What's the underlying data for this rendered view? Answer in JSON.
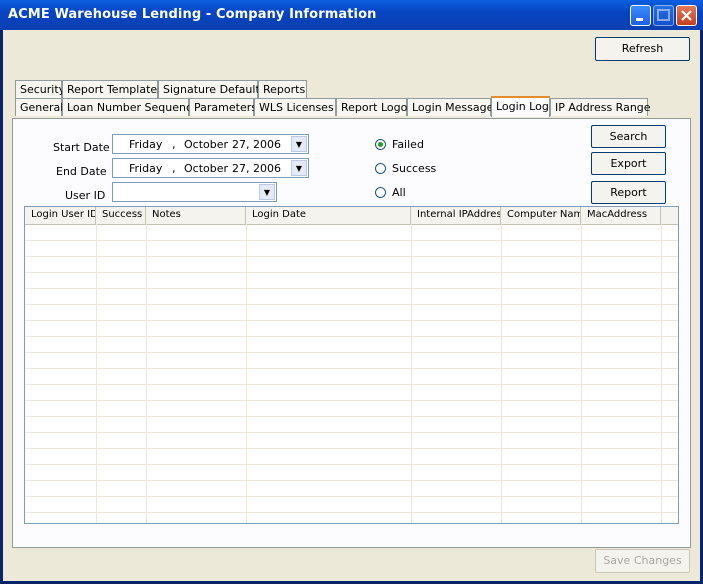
{
  "window": {
    "title": "ACME Warehouse Lending - Company Information"
  },
  "toolbar": {
    "refresh_label": "Refresh",
    "save_changes_label": "Save Changes"
  },
  "tabs_row1": [
    "Security",
    "Report Templates",
    "Signature Defaults",
    "Reports"
  ],
  "tabs_row2": [
    "General",
    "Loan Number Sequence",
    "Parameters",
    "WLS Licenses",
    "Report Logo",
    "Login Message",
    "Login Log",
    "IP Address Range"
  ],
  "active_tab": "Login Log",
  "filters": {
    "start_date_label": "Start Date",
    "start_date": {
      "day": "Friday",
      "month": "October",
      "date": "27, 2006"
    },
    "end_date_label": "End Date",
    "end_date": {
      "day": "Friday",
      "month": "October",
      "date": "27, 2006"
    },
    "user_id_label": "User ID",
    "user_id_value": "",
    "separator": ","
  },
  "status_options": {
    "failed": "Failed",
    "success": "Success",
    "all": "All",
    "selected": "Failed"
  },
  "actions": {
    "search": "Search",
    "export": "Export",
    "report": "Report"
  },
  "grid": {
    "columns": [
      "Login User ID",
      "Success",
      "Notes",
      "Login Date",
      "Internal IPAddress",
      "Computer Name",
      "MacAddress"
    ],
    "rows": []
  }
}
